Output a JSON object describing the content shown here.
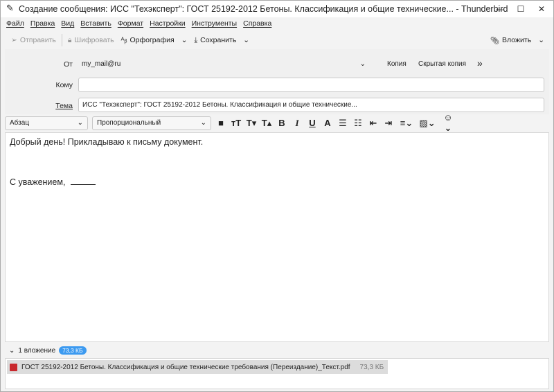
{
  "window": {
    "title": "Создание сообщения: ИСС \"Техэксперт\": ГОСТ 25192-2012 Бетоны. Классификация и общие технические... - Thunderbird",
    "minimize": "—",
    "maximize": "☐",
    "close": "✕"
  },
  "menu": [
    "Файл",
    "Правка",
    "Вид",
    "Вставить",
    "Формат",
    "Настройки",
    "Инструменты",
    "Справка"
  ],
  "toolbar": {
    "send": "Отправить",
    "encrypt": "Шифровать",
    "spelling": "Орфография",
    "save": "Сохранить",
    "attach": "Вложить"
  },
  "header": {
    "from_label": "От",
    "from_value": "my_mail@ru",
    "cc": "Копия",
    "bcc": "Скрытая копия",
    "more": "»",
    "to_label": "Кому",
    "to_value": "",
    "subject_label": "Тема",
    "subject_value": "ИСС \"Техэксперт\": ГОСТ 25192-2012 Бетоны. Классификация и общие технические..."
  },
  "format": {
    "paragraph": "Абзац",
    "font": "Пропорциональный"
  },
  "body": {
    "line1": "Добрый день! Прикладываю к письму документ.",
    "line2": "С уважением,"
  },
  "attachments": {
    "summary": "1 вложение",
    "total_size": "73,3 КБ",
    "items": [
      {
        "name": "ГОСТ 25192-2012 Бетоны. Классификация и общие технические требования (Переиздание)_Текст.pdf",
        "size": "73,3 КБ"
      }
    ]
  }
}
